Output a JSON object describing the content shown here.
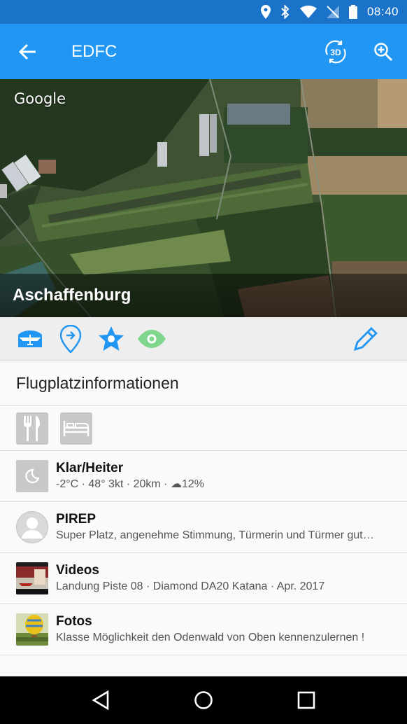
{
  "status_bar": {
    "time": "08:40",
    "icons": [
      "location-icon",
      "bluetooth-icon",
      "wifi-icon",
      "no-signal-icon",
      "battery-icon"
    ]
  },
  "app_bar": {
    "title": "EDFC",
    "back_icon": "arrow-back-icon",
    "actions": [
      "3d-view-icon",
      "zoom-in-icon"
    ],
    "accent_color": "#2196f3",
    "status_color": "#1a73c9"
  },
  "map": {
    "attribution": "Google",
    "place_name": "Aschaffenburg"
  },
  "actions": {
    "items": [
      "airport-icon",
      "directions-pin-icon",
      "favorite-star-icon",
      "watch-eye-icon"
    ],
    "edit": "edit-pencil-icon",
    "icon_color": "#2196f3",
    "eye_color": "#7fd68c"
  },
  "section": {
    "title": "Flugplatzinformationen"
  },
  "amenities": [
    "restaurant-icon",
    "hotel-bed-icon"
  ],
  "rows": {
    "weather": {
      "title": "Klar/Heiter",
      "subtitle": "-2°C · 48° 3kt · 20km · ☁12%",
      "icon": "moon-icon"
    },
    "pirep": {
      "title": "PIREP",
      "subtitle": "Super Platz, angenehme Stimmung, Türmerin und Türmer gut…",
      "icon": "avatar-icon"
    },
    "videos": {
      "title": "Videos",
      "subtitle": "Landung Piste 08 · Diamond DA20 Katana · Apr. 2017",
      "icon": "video-thumbnail"
    },
    "photos": {
      "title": "Fotos",
      "subtitle": "Klasse Möglichkeit den Odenwald von Oben kennenzulernen !",
      "icon": "balloon-photo-thumbnail"
    }
  },
  "nav_bar": {
    "buttons": [
      "back-triangle-icon",
      "home-circle-icon",
      "recents-square-icon"
    ]
  }
}
